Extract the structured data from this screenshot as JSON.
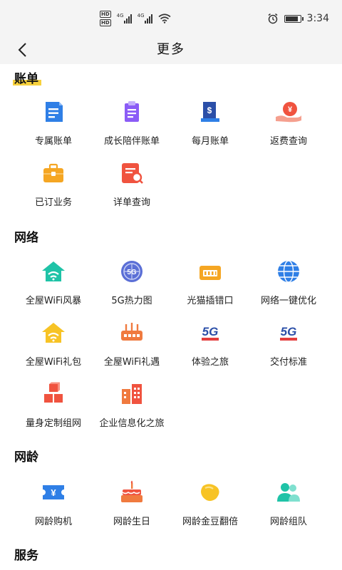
{
  "status": {
    "hd1": "HD",
    "hd2": "HD",
    "net1": "4G",
    "net2": "4G",
    "time": "3:34",
    "battery_level": 0.9
  },
  "nav": {
    "title": "更多"
  },
  "sections": [
    {
      "title": "账单",
      "items": [
        {
          "label": "专属账单",
          "icon": "bill-document-icon"
        },
        {
          "label": "成长陪伴账单",
          "icon": "clipboard-icon"
        },
        {
          "label": "每月账单",
          "icon": "monthly-bill-icon"
        },
        {
          "label": "返费查询",
          "icon": "cashback-hand-icon"
        },
        {
          "label": "已订业务",
          "icon": "briefcase-icon"
        },
        {
          "label": "详单查询",
          "icon": "detail-search-icon"
        }
      ]
    },
    {
      "title": "网络",
      "items": [
        {
          "label": "全屋WiFi风暴",
          "icon": "wifi-house-icon"
        },
        {
          "label": "5G热力图",
          "icon": "globe-5g-icon"
        },
        {
          "label": "光猫插错口",
          "icon": "modem-port-icon"
        },
        {
          "label": "网络一键优化",
          "icon": "globe-icon"
        },
        {
          "label": "全屋WiFi礼包",
          "icon": "wifi-gift-house-icon"
        },
        {
          "label": "全屋WiFi礼遇",
          "icon": "router-icon"
        },
        {
          "label": "体验之旅",
          "icon": "5g-logo-icon",
          "logo_text": "5G"
        },
        {
          "label": "交付标准",
          "icon": "5g-logo-icon",
          "logo_text": "5G"
        },
        {
          "label": "量身定制组网",
          "icon": "cubes-icon"
        },
        {
          "label": "企业信息化之旅",
          "icon": "building-icon"
        }
      ]
    },
    {
      "title": "网龄",
      "items": [
        {
          "label": "网龄购机",
          "icon": "yuan-ticket-icon"
        },
        {
          "label": "网龄生日",
          "icon": "birthday-cake-icon"
        },
        {
          "label": "网龄金豆翻倍",
          "icon": "gold-bean-icon"
        },
        {
          "label": "网龄组队",
          "icon": "team-users-icon"
        }
      ]
    },
    {
      "title": "服务",
      "items": []
    }
  ],
  "colors": {
    "blue": "#2f7fe6",
    "purple": "#8b5cf6",
    "navy": "#2b4fa8",
    "red": "#f0533f",
    "orange": "#f5a623",
    "teal": "#1fc3a7",
    "yellow": "#f7d13d",
    "header_bg": "#f4f4f4"
  }
}
